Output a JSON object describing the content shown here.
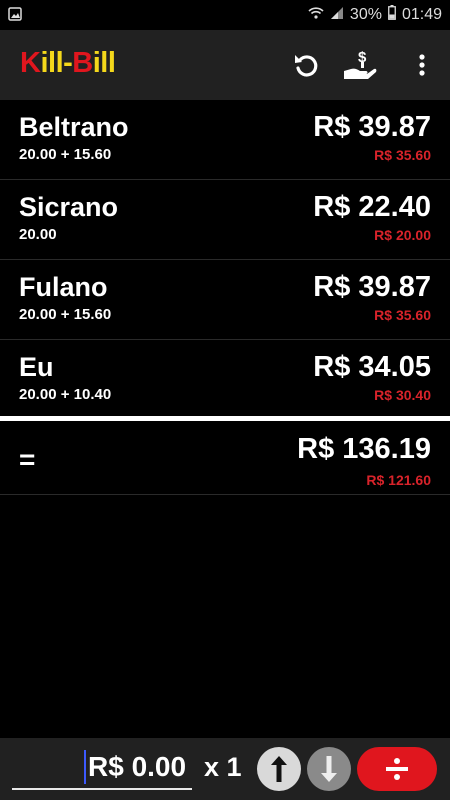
{
  "status": {
    "battery": "30%",
    "time": "01:49"
  },
  "app": {
    "title_part1": "K",
    "title_part2": "ill-",
    "title_part3": "B",
    "title_part4": "ill"
  },
  "people": [
    {
      "name": "Beltrano",
      "detail": "20.00 + 15.60",
      "total": "R$ 39.87",
      "subtotal": "R$ 35.60"
    },
    {
      "name": "Sicrano",
      "detail": "20.00",
      "total": "R$ 22.40",
      "subtotal": "R$ 20.00"
    },
    {
      "name": "Fulano",
      "detail": "20.00 + 15.60",
      "total": "R$ 39.87",
      "subtotal": "R$ 35.60"
    },
    {
      "name": "Eu",
      "detail": "20.00 + 10.40",
      "total": "R$ 34.05",
      "subtotal": "R$ 30.40"
    }
  ],
  "summary": {
    "label": "=",
    "total": "R$ 136.19",
    "subtotal": "R$ 121.60"
  },
  "input": {
    "amount": "R$ 0.00",
    "multiplier": "x 1"
  },
  "icons": {
    "undo": "undo-icon",
    "pay": "hand-coin-icon",
    "menu": "more-vert-icon",
    "up": "arrow-up-icon",
    "down": "arrow-down-icon",
    "divide": "divide-icon"
  },
  "colors": {
    "accent_red": "#e0161e",
    "accent_yellow": "#f4d81b",
    "bar": "#212121"
  }
}
